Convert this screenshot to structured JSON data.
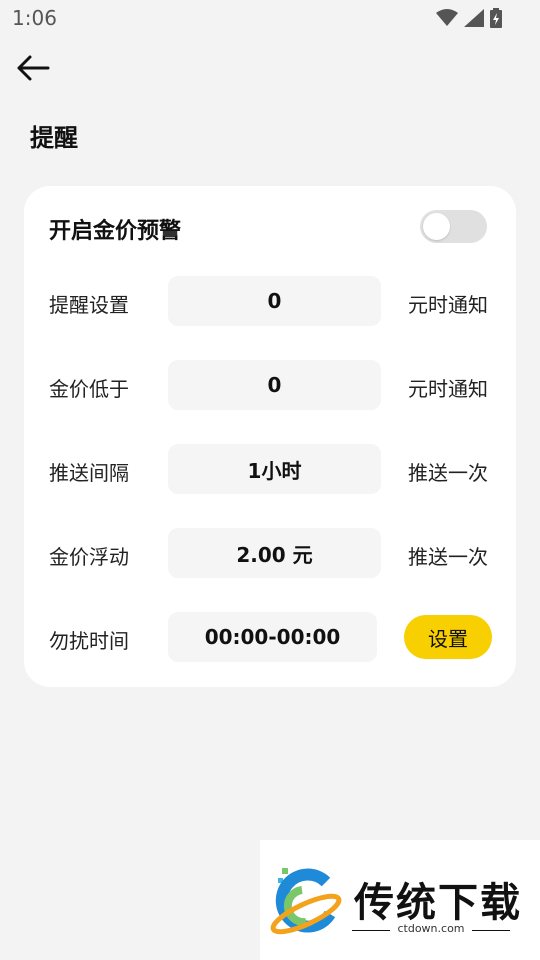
{
  "status_bar": {
    "time": "1:06"
  },
  "page": {
    "title": "提醒"
  },
  "alert": {
    "toggle_label": "开启金价预警",
    "enabled": false
  },
  "rows": [
    {
      "label": "提醒设置",
      "value": "0",
      "suffix": "元时通知"
    },
    {
      "label": "金价低于",
      "value": "0",
      "suffix": "元时通知"
    },
    {
      "label": "推送间隔",
      "value": "1小时",
      "suffix": "推送一次"
    },
    {
      "label": "金价浮动",
      "value": "2.00 元",
      "suffix": "推送一次"
    },
    {
      "label": "勿扰时间",
      "value": "00:00-00:00",
      "button": "设置"
    }
  ],
  "watermark": {
    "brand": "传统下载",
    "url": "ctdown.com"
  },
  "colors": {
    "accent": "#f8cf00",
    "background": "#f3f3f3",
    "card": "#ffffff"
  }
}
